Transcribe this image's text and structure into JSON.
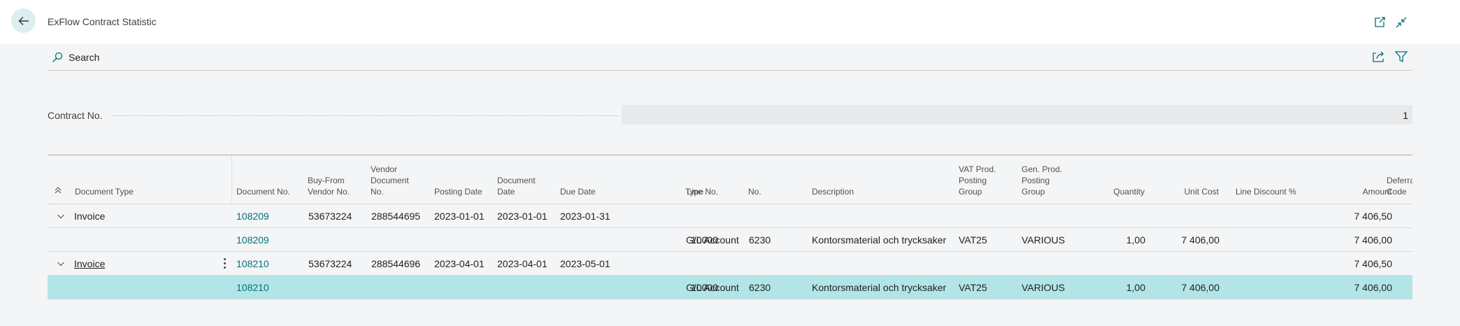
{
  "page": {
    "title": "ExFlow Contract Statistic"
  },
  "toolbar": {
    "search_label": "Search"
  },
  "field": {
    "label": "Contract No.",
    "value": "1"
  },
  "grid": {
    "headers": {
      "document_type": "Document Type",
      "document_no": "Document No.",
      "buy_from_vendor_no": "Buy-From Vendor No.",
      "vendor_document_no": "Vendor Document No.",
      "posting_date": "Posting Date",
      "document_date": "Document Date",
      "due_date": "Due Date",
      "line_no": "Line No.",
      "type": "Type",
      "no": "No.",
      "description": "Description",
      "vat_prod_posting_group": "VAT Prod. Posting Group",
      "gen_prod_posting_group": "Gen. Prod. Posting Group",
      "quantity": "Quantity",
      "unit_cost": "Unit Cost",
      "line_discount": "Line Discount %",
      "amount": "Amount",
      "deferral_code": "Deferral Code"
    },
    "rows": [
      {
        "document_type": "Invoice",
        "document_no": "108209",
        "vendor_no": "53673224",
        "vendor_doc_no": "288544695",
        "posting_date": "2023-01-01",
        "document_date": "2023-01-01",
        "due_date": "2023-01-31",
        "amount": "7 406,50"
      },
      {
        "document_no": "108209",
        "line_no": "10000",
        "type": "G/L Account",
        "no": "6230",
        "description": "Kontorsmaterial och trycksaker",
        "vat_group": "VAT25",
        "gen_group": "VARIOUS",
        "quantity": "1,00",
        "unit_cost": "7 406,00",
        "amount": "7 406,00"
      },
      {
        "document_type": "Invoice",
        "document_no": "108210",
        "vendor_no": "53673224",
        "vendor_doc_no": "288544696",
        "posting_date": "2023-04-01",
        "document_date": "2023-04-01",
        "due_date": "2023-05-01",
        "amount": "7 406,50"
      },
      {
        "document_no": "108210",
        "line_no": "10000",
        "type": "G/L Account",
        "no": "6230",
        "description": "Kontorsmaterial och trycksaker",
        "vat_group": "VAT25",
        "gen_group": "VARIOUS",
        "quantity": "1,00",
        "unit_cost": "7 406,00",
        "amount": "7 406,00"
      }
    ]
  },
  "colors": {
    "accent": "#00707a",
    "selected_row": "#b3e5e8",
    "back_button_bg": "#dceef0"
  },
  "icons": [
    "back-arrow-icon",
    "open-in-new-window-icon",
    "collapse-icon",
    "search-icon",
    "share-icon",
    "filter-icon",
    "collapse-all-icon",
    "chevron-down-icon",
    "more-options-icon"
  ]
}
